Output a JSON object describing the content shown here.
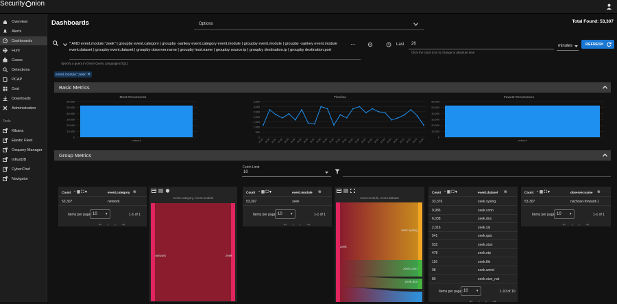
{
  "brand": "Security",
  "brand_suffix": "nion",
  "nav": [
    "Overview",
    "Alerts",
    "Dashboards",
    "Hunt",
    "Cases",
    "Detections",
    "PCAP",
    "Grid",
    "Downloads",
    "Administration"
  ],
  "tools_label": "Tools",
  "tools": [
    "Kibana",
    "Elastic Fleet",
    "Osquery Manager",
    "InfluxDB",
    "CyberChef",
    "Navigator"
  ],
  "page_title": "Dashboards",
  "options_label": "Options",
  "total_found": "Total Found: 53,307",
  "query": "* AND event.module:\"zeek\" | groupby event.category | groupby -sankey event.category event.module | groupby event.module | groupby -sankey event.module event.dataset | groupby event.dataset | groupby observer.name | groupby host.name | groupby source.ip | groupby destination.ip | groupby destination.port",
  "query_hint": "Specify a query in Onion Query Language (OQL)",
  "last_label": "Last",
  "last_value": "26",
  "clock_hint": "Click the clock icon to change to absolute time",
  "units": "minutes",
  "refresh": "REFRESH",
  "filter_chip": "event.module:\"zeek\"",
  "basic_metrics": "Basic Metrics",
  "group_metrics": "Group Metrics",
  "fetch_limit_label": "Fetch Limit",
  "fetch_limit": "10",
  "count_label": "Count",
  "most_title": "Most Occurrences",
  "timeline_title": "Timeline",
  "fewest_title": "Fewest Occurrences",
  "bar_yticks": [
    "60,000",
    "50,000",
    "40,000",
    "30,000",
    "20,000",
    "10,000",
    "0"
  ],
  "bar_xlabel": "network",
  "tl_yticks": [
    "3,500",
    "3,000",
    "2,500",
    "2,000",
    "1,500",
    "1,000",
    "500",
    "0"
  ],
  "tl_xlabels": [
    "16:29",
    "16:30",
    "16:31",
    "16:32",
    "16:33",
    "16:34",
    "16:35",
    "16:36",
    "16:37",
    "16:38",
    "16:39",
    "16:40",
    "16:41",
    "16:42",
    "16:43",
    "16:44",
    "16:45",
    "16:46",
    "16:47",
    "16:48",
    "16:49",
    "16:50",
    "16:51",
    "16:52",
    "16:53",
    "16:54"
  ],
  "chart_data": [
    {
      "type": "bar",
      "categories": [
        "network"
      ],
      "values": [
        53307
      ],
      "ylim": [
        0,
        60000
      ]
    },
    {
      "type": "line",
      "x": [
        "16:29",
        "16:30",
        "16:31",
        "16:32",
        "16:33",
        "16:34",
        "16:35",
        "16:36",
        "16:37",
        "16:38",
        "16:39",
        "16:40",
        "16:41",
        "16:42",
        "16:43",
        "16:44",
        "16:45",
        "16:46",
        "16:47",
        "16:48",
        "16:49",
        "16:50",
        "16:51",
        "16:52",
        "16:53",
        "16:54"
      ],
      "series": [
        {
          "values": [
            1200,
            2700,
            2200,
            1900,
            2300,
            1700,
            2700,
            1400,
            1300,
            3000,
            2800,
            1200,
            2200,
            1900,
            2800,
            3000,
            2400,
            2800,
            2500,
            2400,
            1700,
            1900,
            2200,
            2700,
            2100,
            1200
          ]
        }
      ],
      "ylim": [
        0,
        3500
      ]
    },
    {
      "type": "bar",
      "categories": [
        "network"
      ],
      "values": [
        53307
      ],
      "ylim": [
        0,
        60000
      ]
    }
  ],
  "tables": {
    "t1": {
      "col": "event.category",
      "rows": [
        [
          "53,307",
          "network"
        ]
      ],
      "range": "1-1 of 1"
    },
    "t2": {
      "col": "event.module",
      "rows": [
        [
          "53,307",
          "zeek"
        ]
      ],
      "range": "1-1 of 1"
    },
    "t3": {
      "col": "event.dataset",
      "rows": [
        [
          "33,376",
          "zeek.syslog"
        ],
        [
          "9,986",
          "zeek.conn"
        ],
        [
          "6,038",
          "zeek.dns"
        ],
        [
          "2,016",
          "zeek.ssl"
        ],
        [
          "541",
          "zeek.quic"
        ],
        [
          "532",
          "zeek.stun"
        ],
        [
          "478",
          "zeek.ntp"
        ],
        [
          "116",
          "zeek.file"
        ],
        [
          "98",
          "zeek.weird"
        ],
        [
          "80",
          "zeek.stun_nat"
        ]
      ],
      "range": "1-10 of 10"
    },
    "t4": {
      "col": "observer.name",
      "rows": [
        [
          "53,307",
          "nachoso-forward-1"
        ]
      ],
      "range": "1-1 of 1"
    }
  },
  "items_per_page": "Items per page:",
  "ipp_value": "10",
  "sankey1": {
    "title": "event.category, event.module",
    "left": "network",
    "right": "zeek"
  },
  "sankey2": {
    "title": "event.module, event.dataset",
    "left": "zeek",
    "nodes": [
      "zeek.syslog",
      "zeek.conn",
      "zeek.dns"
    ]
  }
}
